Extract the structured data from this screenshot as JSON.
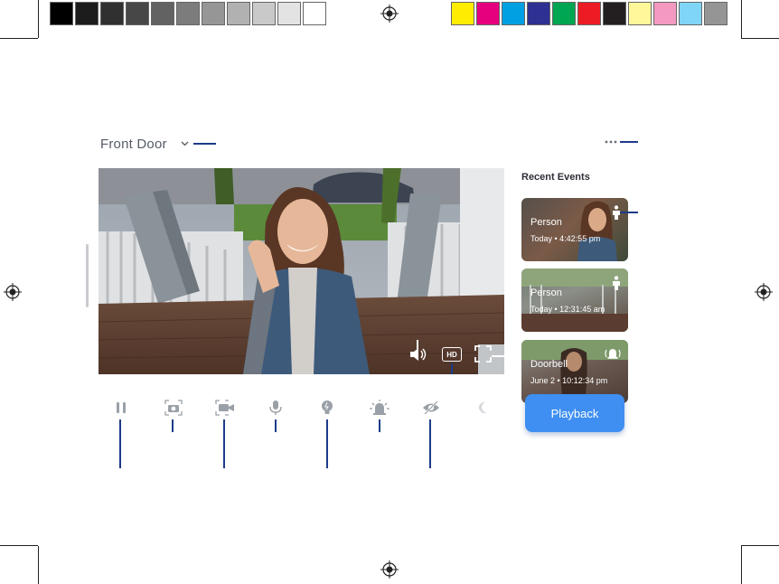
{
  "colors": {
    "accent": "#3f8ff2",
    "callout": "#1d3b8a",
    "grays": [
      "#000000",
      "#1c1c1c",
      "#303030",
      "#474747",
      "#626262",
      "#7c7c7c",
      "#969696",
      "#b1b1b1",
      "#c9c9c9",
      "#e3e3e3",
      "#ffffff"
    ],
    "process": [
      "#ffec00",
      "#e6007e",
      "#00a0e3",
      "#2e3192",
      "#00a651",
      "#ed1c24",
      "#231f20",
      "#fff799",
      "#f49ac1",
      "#7fd5f5",
      "#959595"
    ]
  },
  "header": {
    "device_name": "Front Door",
    "chevron_icon": "chevron-down-icon",
    "more_icon": "more-dots-icon"
  },
  "live_view": {
    "overlay_icons": [
      "volume-icon",
      "hd-icon",
      "fullscreen-icon"
    ],
    "hd_label": "HD"
  },
  "controls": [
    {
      "name": "pause-icon"
    },
    {
      "name": "snapshot-icon"
    },
    {
      "name": "record-icon"
    },
    {
      "name": "microphone-icon"
    },
    {
      "name": "light-icon"
    },
    {
      "name": "siren-icon"
    },
    {
      "name": "privacy-icon"
    },
    {
      "name": "night-mode-icon"
    }
  ],
  "side_panel": {
    "title": "Recent Events",
    "events": [
      {
        "type": "Person",
        "time": "Today • 4:42:55 pm",
        "icon": "person-icon"
      },
      {
        "type": "Person",
        "time": "Today • 12:31:45 am",
        "icon": "person-icon"
      },
      {
        "type": "Doorbell",
        "time": "June 2 • 10:12:34 pm",
        "icon": "doorbell-ring-icon"
      }
    ],
    "playback_label": "Playback"
  }
}
